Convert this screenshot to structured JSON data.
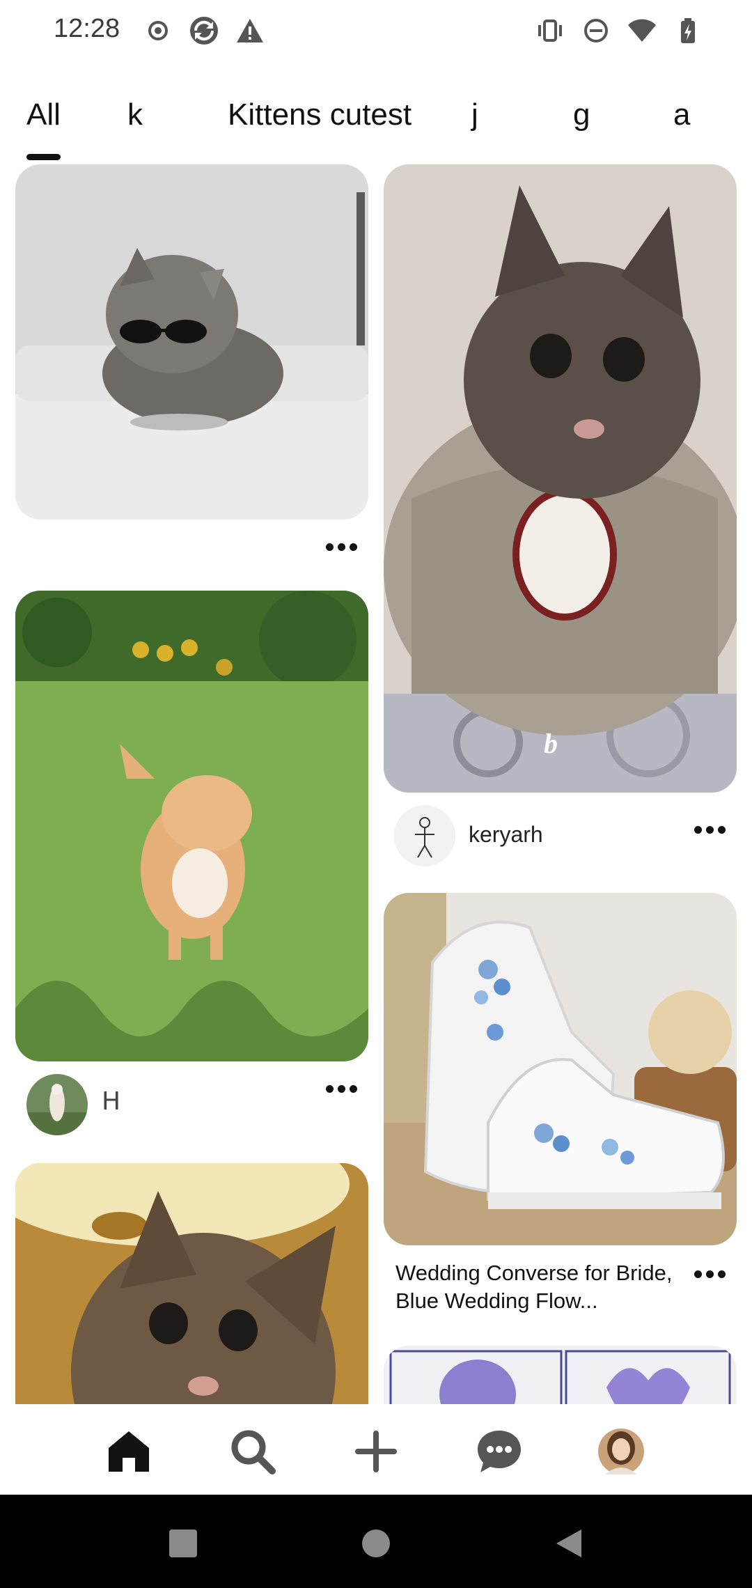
{
  "status_bar": {
    "time": "12:28",
    "left_icons": [
      "record-icon",
      "sync-icon",
      "warning-icon"
    ],
    "right_icons": [
      "vibrate-icon",
      "do-not-disturb-icon",
      "wifi-icon",
      "battery-charging-icon"
    ]
  },
  "tabs": [
    {
      "label": "All",
      "active": true
    },
    {
      "label": "k",
      "active": false
    },
    {
      "label": "Kittens cutest",
      "active": false
    },
    {
      "label": "j",
      "active": false
    },
    {
      "label": "g",
      "active": false
    },
    {
      "label": "a",
      "active": false
    }
  ],
  "pins": {
    "kitten_sunglasses": {
      "image": "kitten-with-sunglasses-image"
    },
    "kitten_sweater": {
      "image": "kitten-in-sweater-image",
      "overlay_text": "b",
      "user": "keryarh"
    },
    "kitten_grass": {
      "image": "orange-kitten-in-grass-image",
      "user_signature": "ᕼ"
    },
    "converse": {
      "image": "embroidered-white-converse-image",
      "title": "Wedding Converse for Bride, Blue Wedding Flow..."
    },
    "tabby_kitten": {
      "image": "tabby-kitten-under-lamp-image"
    },
    "illustration": {
      "image": "purple-illustration-image"
    }
  },
  "bottom_nav": [
    "home-icon",
    "search-icon",
    "create-icon",
    "messages-icon",
    "profile-avatar"
  ],
  "system_nav": [
    "recents-icon",
    "home-circle-icon",
    "back-icon"
  ],
  "colors": {
    "text": "#111111",
    "background": "#ffffff",
    "system_nav": "#000000"
  }
}
